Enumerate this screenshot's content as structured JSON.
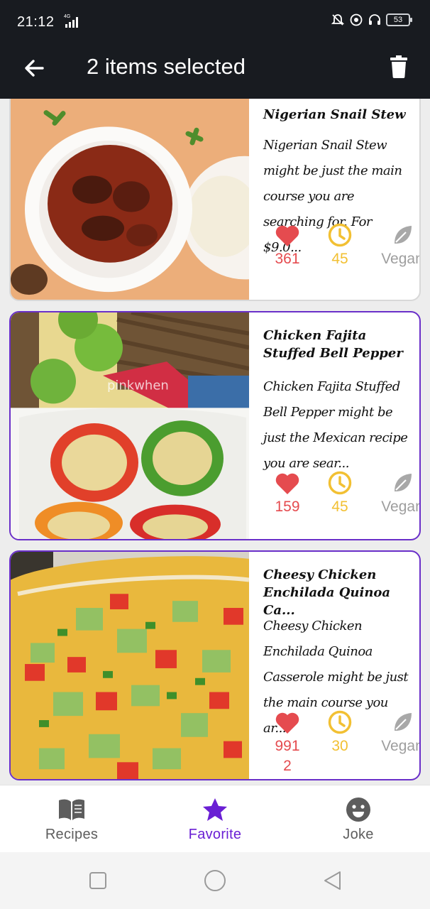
{
  "status_bar": {
    "time": "21:12",
    "network": "4G",
    "battery": "53",
    "icons": [
      "mute-bell-icon",
      "data-saver-icon",
      "headset-icon",
      "battery-icon"
    ]
  },
  "action_bar": {
    "title": "2 items selected",
    "back_icon": "arrow-back-icon",
    "delete_icon": "trash-icon"
  },
  "colors": {
    "accent": "#6a1fd4",
    "selected_border": "#6a2fc9",
    "heart": "#e54b4f",
    "clock": "#f2c033",
    "leaf": "#9e9e9e",
    "bar": "#181b20"
  },
  "recipes": [
    {
      "title": "Nigerian Snail Stew",
      "description": "Nigerian Snail Stew might be just the main course you are searching for. For $9.0...",
      "likes": "361",
      "minutes": "45",
      "vegan_label": "Vegan",
      "selected": false
    },
    {
      "title": "Chicken Fajita Stuffed Bell Pepper",
      "description": "Chicken Fajita Stuffed Bell Pepper might be just the Mexican recipe you are sear...",
      "likes": "159",
      "minutes": "45",
      "vegan_label": "Vegan",
      "image_watermark": "pinkwhen",
      "selected": true
    },
    {
      "title": "Cheesy Chicken Enchilada Quinoa Ca...",
      "description": "Cheesy Chicken Enchilada Quinoa Casserole might be just the main course you ar...",
      "likes": "991\n2",
      "minutes": "30",
      "vegan_label": "Vegan",
      "selected": true
    }
  ],
  "bottom_nav": [
    {
      "label": "Recipes",
      "icon": "book-icon",
      "active": false
    },
    {
      "label": "Favorite",
      "icon": "star-icon",
      "active": true
    },
    {
      "label": "Joke",
      "icon": "smiley-icon",
      "active": false
    }
  ],
  "system_nav": [
    "recents-square-icon",
    "home-circle-icon",
    "back-triangle-icon"
  ]
}
